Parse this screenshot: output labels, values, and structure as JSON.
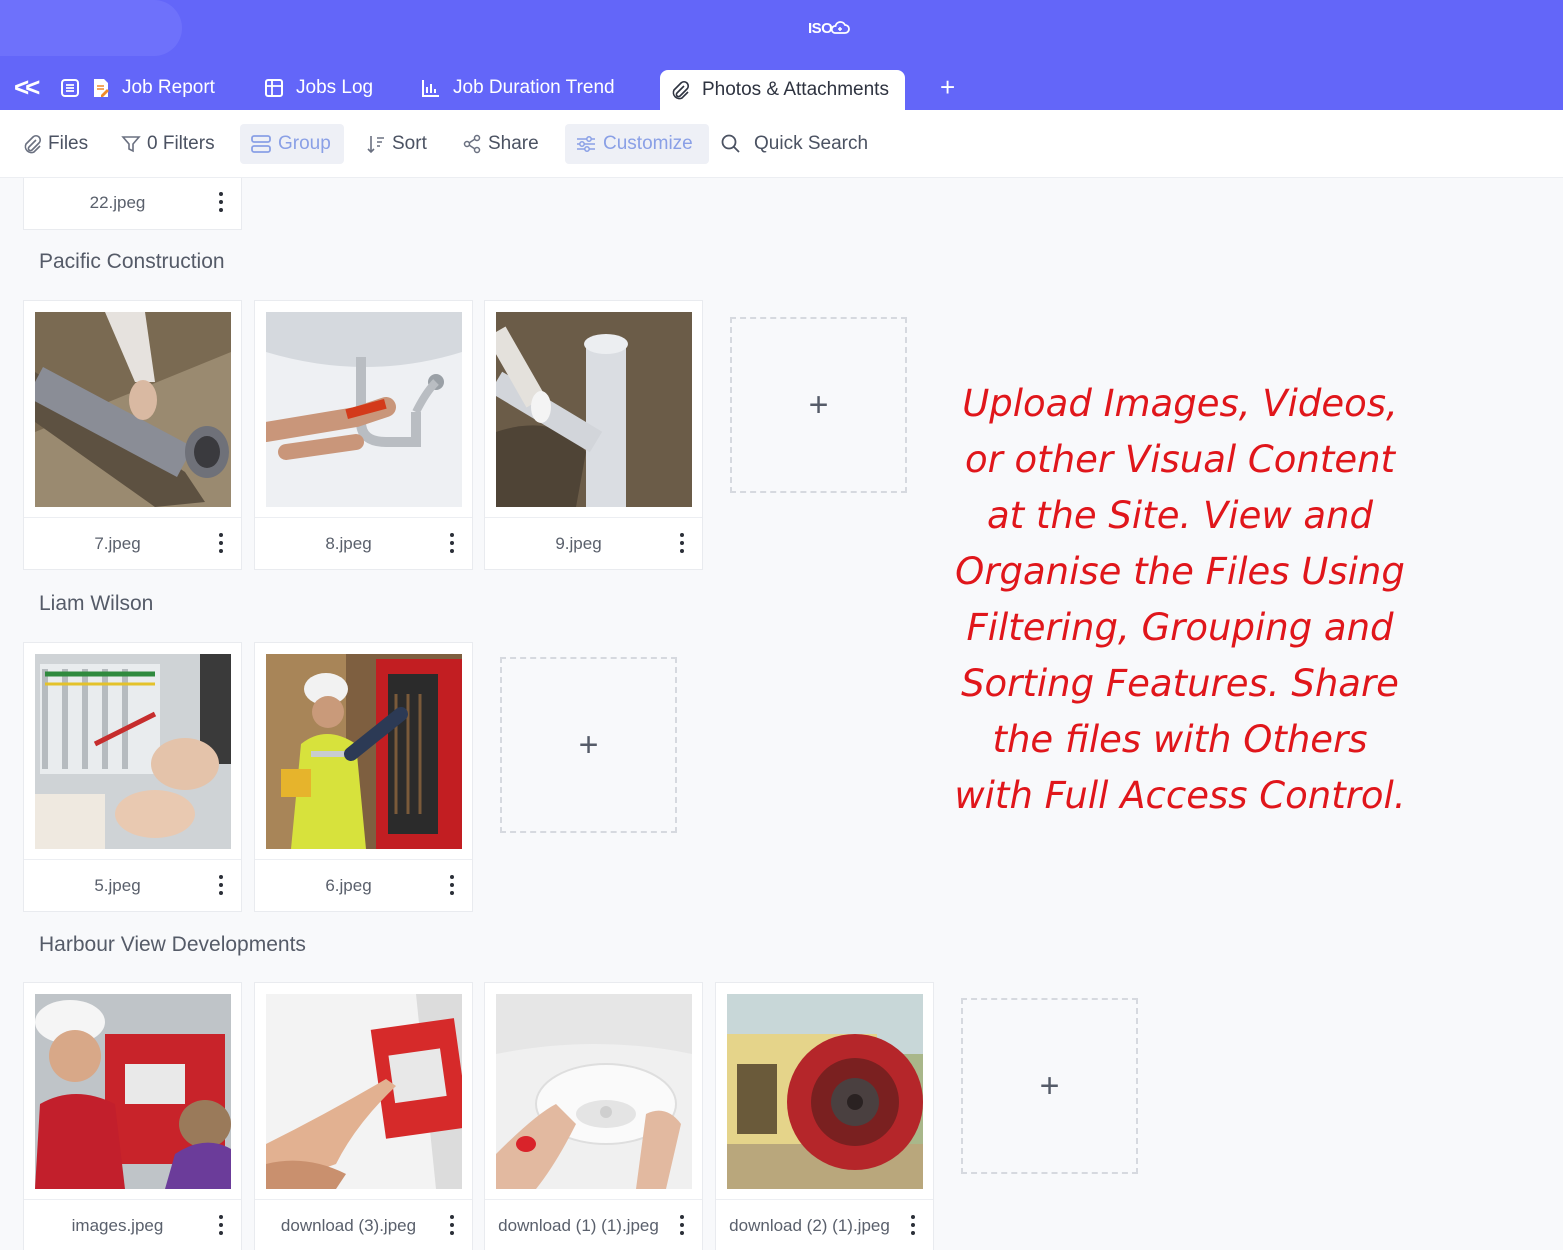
{
  "app": {
    "logo_text": "ISO"
  },
  "tabs": [
    {
      "label": "Job Report"
    },
    {
      "label": "Jobs Log"
    },
    {
      "label": "Job Duration Trend"
    },
    {
      "label": "Photos & Attachments",
      "active": true
    }
  ],
  "toolbar": {
    "files": "Files",
    "filters": "0 Filters",
    "group": "Group",
    "sort": "Sort",
    "share": "Share",
    "customize": "Customize",
    "quick_search": "Quick Search"
  },
  "groups": [
    {
      "title": "",
      "files": [
        "22.jpeg"
      ]
    },
    {
      "title": "Pacific Construction",
      "files": [
        "7.jpeg",
        "8.jpeg",
        "9.jpeg"
      ]
    },
    {
      "title": "Liam Wilson",
      "files": [
        "5.jpeg",
        "6.jpeg"
      ]
    },
    {
      "title": "Harbour View Developments",
      "files": [
        "images.jpeg",
        "download (3).jpeg",
        "download (1) (1).jpeg",
        "download (2) (1).jpeg"
      ]
    }
  ],
  "add_symbol": "+",
  "promo_lines": [
    "Upload Images, Videos,",
    "or other Visual Content",
    "at the Site. View and",
    "Organise the Files Using",
    "Filtering, Grouping and",
    "Sorting Features. Share",
    "the files with Others",
    "with Full Access Control."
  ],
  "colors": {
    "header": "#6366f9",
    "promo": "#e0161b",
    "accent": "#8aa0e6"
  }
}
